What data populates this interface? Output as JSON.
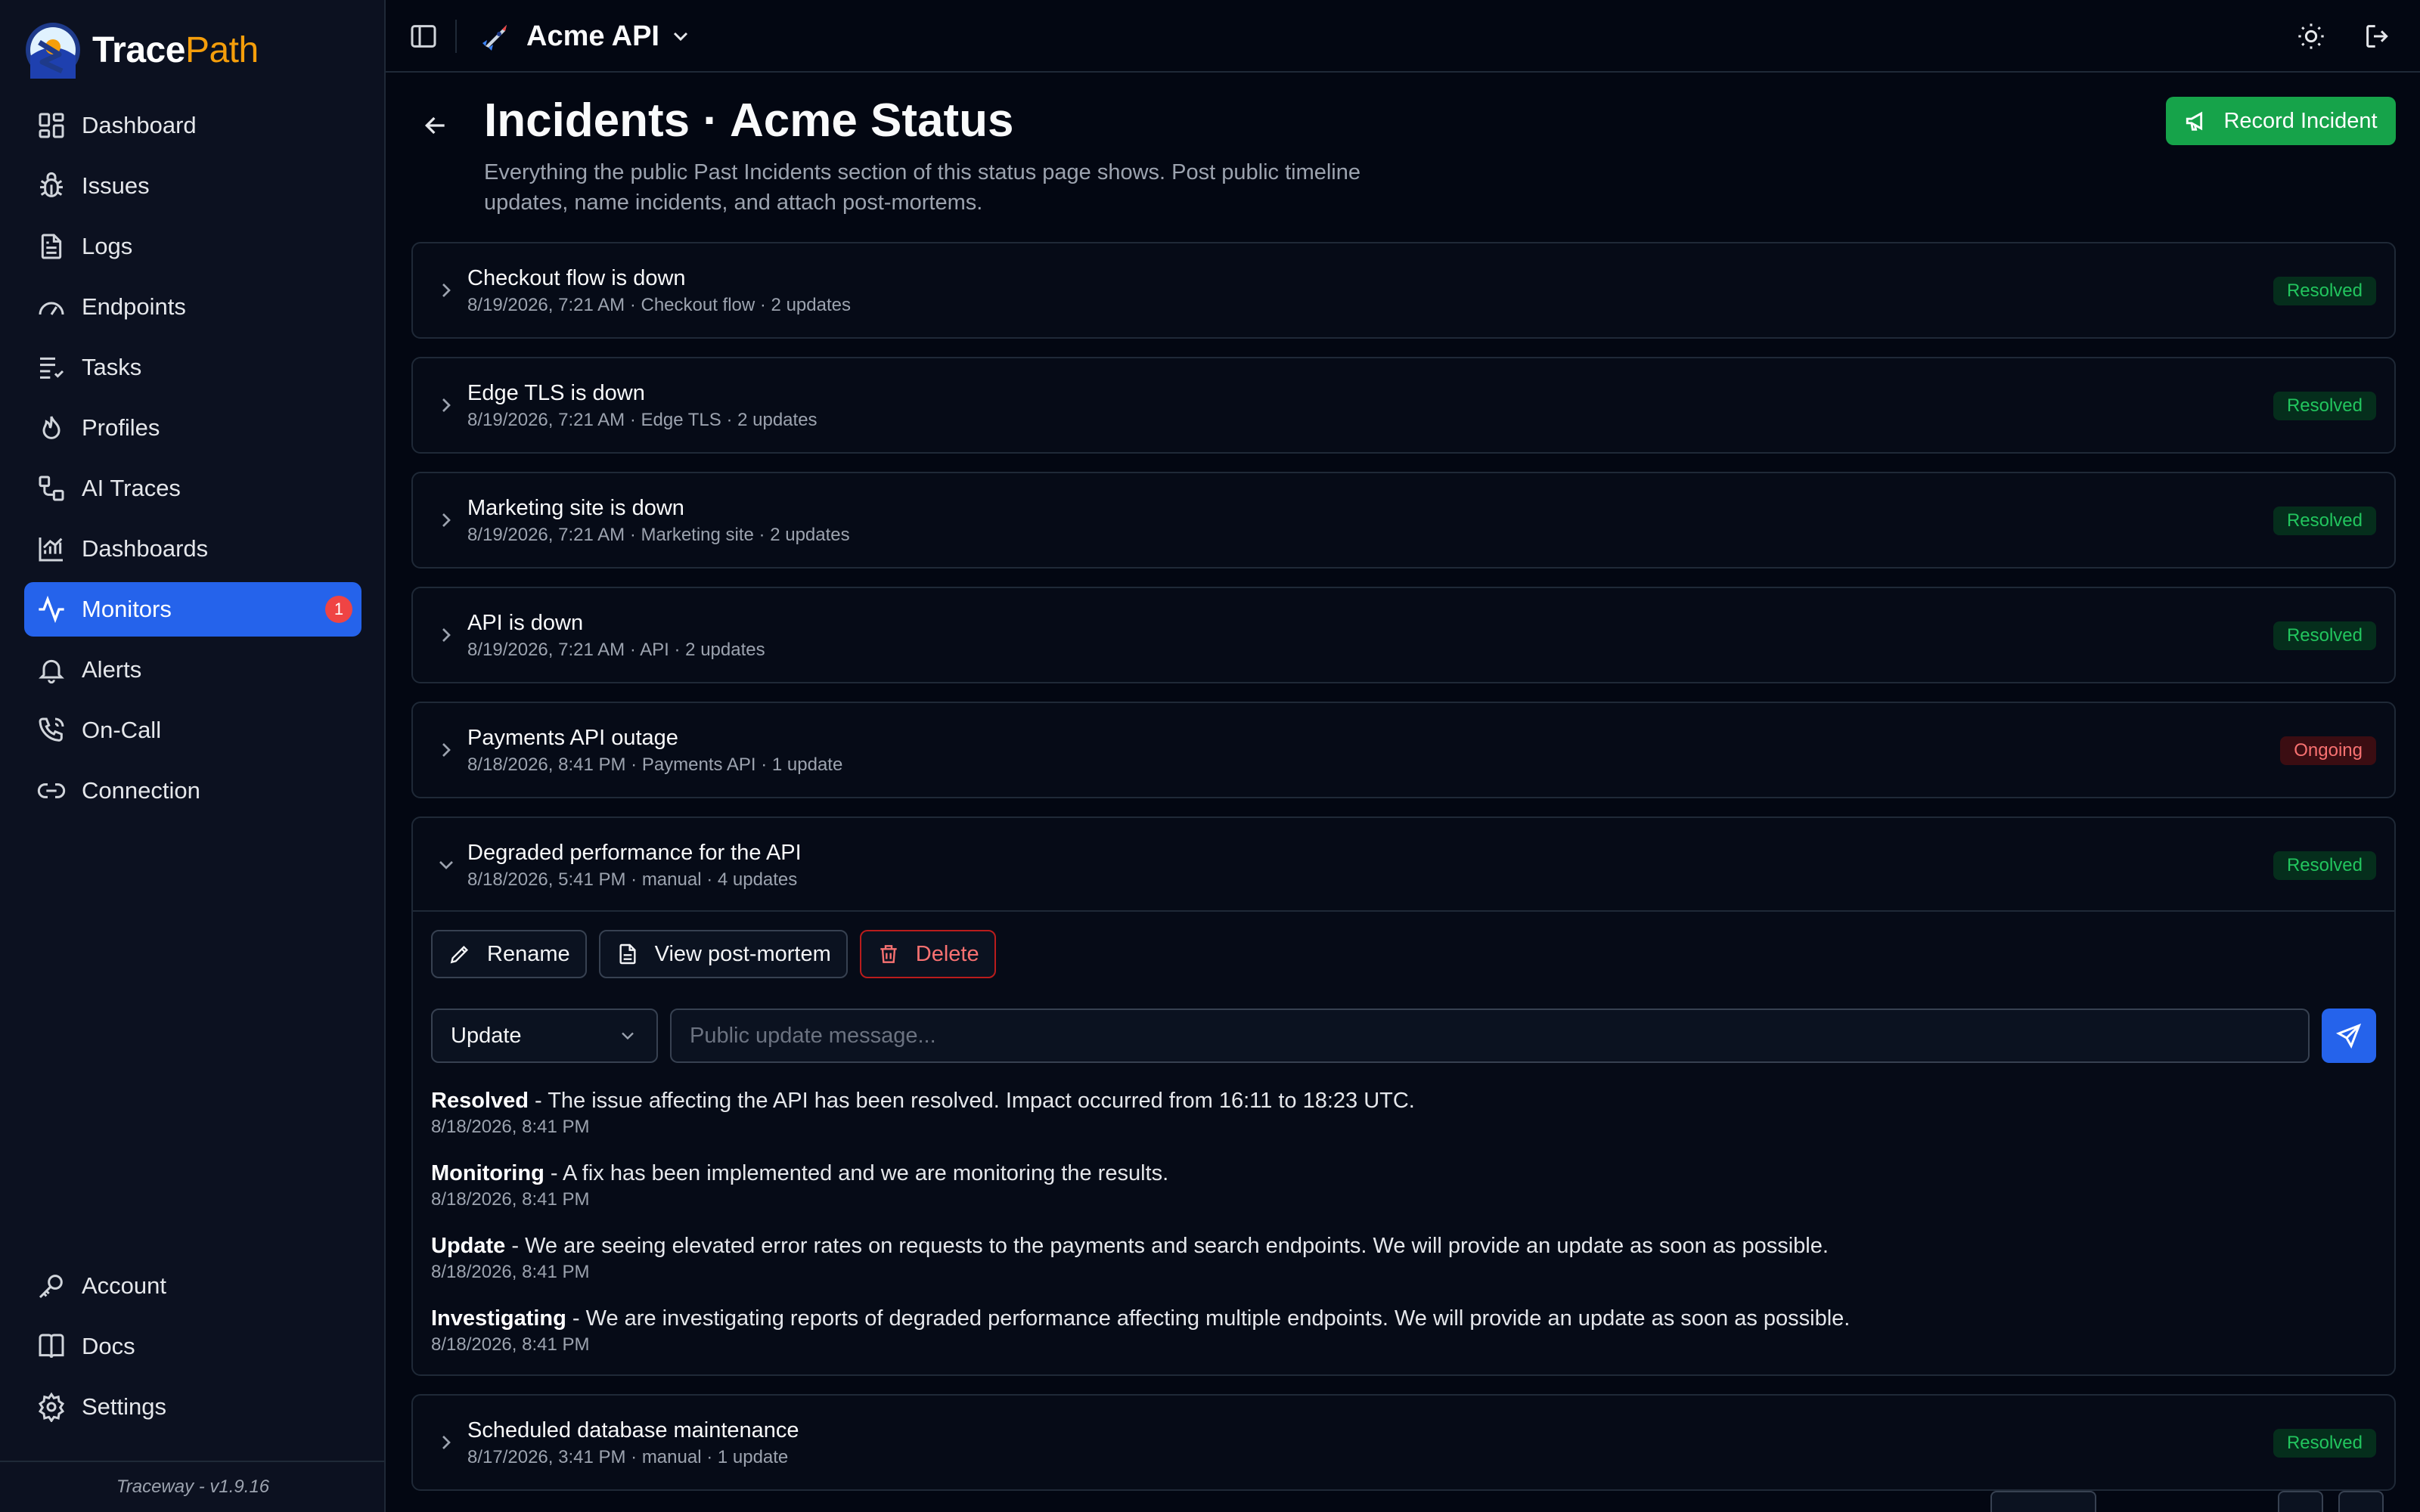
{
  "brand": {
    "name_part1": "Trace",
    "name_part2": "Path",
    "version": "Traceway - v1.9.16"
  },
  "sidebar": {
    "items": [
      {
        "label": "Dashboard",
        "icon": "dashboard-icon"
      },
      {
        "label": "Issues",
        "icon": "bug-icon"
      },
      {
        "label": "Logs",
        "icon": "file-text-icon"
      },
      {
        "label": "Endpoints",
        "icon": "gauge-icon"
      },
      {
        "label": "Tasks",
        "icon": "list-checks-icon"
      },
      {
        "label": "Profiles",
        "icon": "flame-icon"
      },
      {
        "label": "AI Traces",
        "icon": "workflow-icon"
      },
      {
        "label": "Dashboards",
        "icon": "chart-icon"
      },
      {
        "label": "Monitors",
        "icon": "activity-icon",
        "active": true,
        "badge": "1"
      },
      {
        "label": "Alerts",
        "icon": "bell-icon"
      },
      {
        "label": "On-Call",
        "icon": "phone-icon"
      },
      {
        "label": "Connection",
        "icon": "link-icon"
      }
    ],
    "bottom_items": [
      {
        "label": "Account",
        "icon": "key-icon"
      },
      {
        "label": "Docs",
        "icon": "book-icon"
      },
      {
        "label": "Settings",
        "icon": "gear-icon"
      }
    ]
  },
  "topbar": {
    "project_name": "Acme API"
  },
  "header": {
    "title": "Incidents · Acme Status",
    "subtitle": "Everything the public Past Incidents section of this status page shows. Post public timeline updates, name incidents, and attach post-mortems.",
    "record_button": "Record Incident"
  },
  "incidents": [
    {
      "title": "Checkout flow is down",
      "meta": "8/19/2026, 7:21 AM · Checkout flow · 2 updates",
      "status": "Resolved"
    },
    {
      "title": "Edge TLS is down",
      "meta": "8/19/2026, 7:21 AM · Edge TLS · 2 updates",
      "status": "Resolved"
    },
    {
      "title": "Marketing site is down",
      "meta": "8/19/2026, 7:21 AM · Marketing site · 2 updates",
      "status": "Resolved"
    },
    {
      "title": "API is down",
      "meta": "8/19/2026, 7:21 AM · API · 2 updates",
      "status": "Resolved"
    },
    {
      "title": "Payments API outage",
      "meta": "8/18/2026, 8:41 PM · Payments API · 1 update",
      "status": "Ongoing"
    },
    {
      "title": "Degraded performance for the API",
      "meta": "8/18/2026, 5:41 PM · manual · 4 updates",
      "status": "Resolved",
      "expanded": true,
      "actions": {
        "rename": "Rename",
        "postmortem": "View post-mortem",
        "delete": "Delete"
      },
      "composer": {
        "type_value": "Update",
        "placeholder": "Public update message..."
      },
      "updates": [
        {
          "type": "Resolved",
          "text": " - The issue affecting the API has been resolved. Impact occurred from 16:11 to 18:23 UTC.",
          "time": "8/18/2026, 8:41 PM"
        },
        {
          "type": "Monitoring",
          "text": " - A fix has been implemented and we are monitoring the results.",
          "time": "8/18/2026, 8:41 PM"
        },
        {
          "type": "Update",
          "text": " - We are seeing elevated error rates on requests to the payments and search endpoints. We will provide an update as soon as possible.",
          "time": "8/18/2026, 8:41 PM"
        },
        {
          "type": "Investigating",
          "text": " - We are investigating reports of degraded performance affecting multiple endpoints. We will provide an update as soon as possible.",
          "time": "8/18/2026, 8:41 PM"
        }
      ]
    },
    {
      "title": "Scheduled database maintenance",
      "meta": "8/17/2026, 3:41 PM · manual · 1 update",
      "status": "Resolved"
    }
  ]
}
